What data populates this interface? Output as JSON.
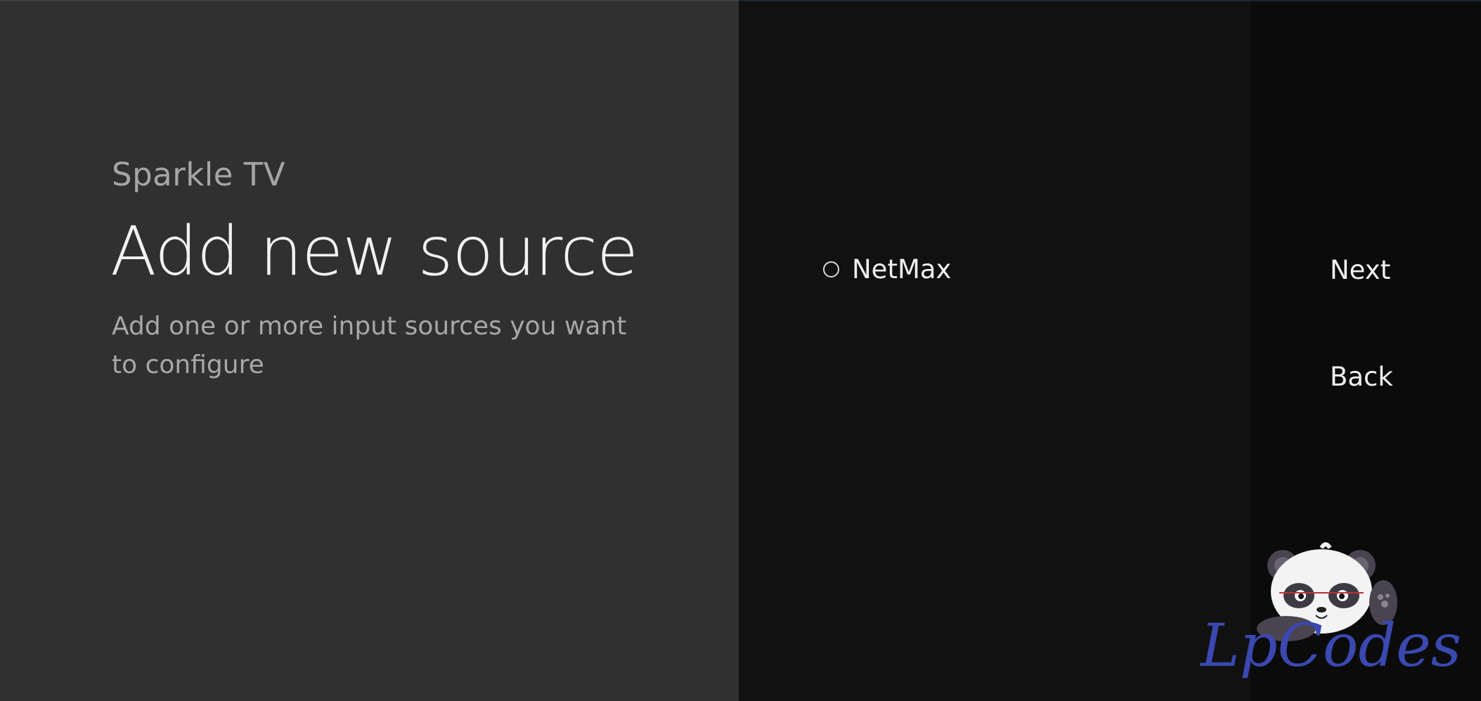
{
  "left_panel": {
    "brand": "Sparkle TV",
    "title": "Add new source",
    "description": "Add one or more input sources you want to configure"
  },
  "sources": [
    {
      "label": "NetMax",
      "selected": false
    }
  ],
  "actions": {
    "next_label": "Next",
    "back_label": "Back"
  },
  "watermark": {
    "text": "LpCodes",
    "color": "#3a48b0"
  },
  "colors": {
    "left_bg": "#303030",
    "middle_bg": "#111111",
    "right_bg": "#0b0b0b"
  }
}
